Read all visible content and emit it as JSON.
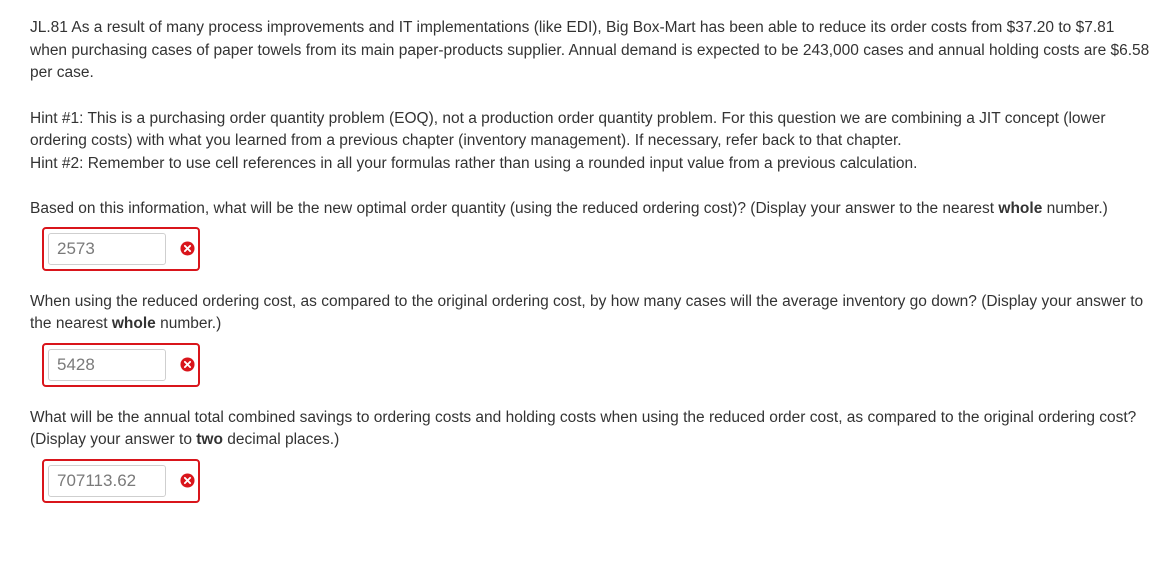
{
  "problem": {
    "intro": "JL.81 As a result of many process improvements and IT implementations (like EDI), Big Box-Mart has been able to reduce its order costs from $37.20 to $7.81 when purchasing cases of paper towels from its main paper-products supplier. Annual demand is expected to be 243,000 cases and annual holding costs are $6.58 per case.",
    "hint1": "Hint #1: This is a purchasing order quantity problem (EOQ), not a production order quantity problem. For this question we are combining a JIT concept (lower ordering costs) with what you learned from a previous chapter (inventory management).  If necessary, refer back to that chapter.",
    "hint2": "Hint #2: Remember to use cell references in all your formulas rather than using a rounded input value from a previous calculation."
  },
  "questions": [
    {
      "text_before": "Based on this information, what will be the new optimal order quantity (using the reduced ordering cost)? (Display your answer to the nearest ",
      "emphasis": "whole",
      "text_after": " number.)",
      "answer": "2573",
      "status": "incorrect"
    },
    {
      "text_before": "When using the reduced ordering cost, as compared to the original ordering cost, by how many cases will the average inventory go down? (Display your answer to the nearest ",
      "emphasis": "whole",
      "text_after": " number.)",
      "answer": "5428",
      "status": "incorrect"
    },
    {
      "text_before": "What will be the annual total combined savings to ordering costs and holding costs when using the reduced order cost, as compared to the original ordering cost? (Display your answer to ",
      "emphasis": "two",
      "text_after": " decimal places.)",
      "answer": "707113.62",
      "status": "incorrect"
    }
  ],
  "icons": {
    "status": "incorrect-x-icon"
  },
  "colors": {
    "error_border": "#d9151b",
    "error_icon": "#d9151b",
    "text": "#333333"
  }
}
